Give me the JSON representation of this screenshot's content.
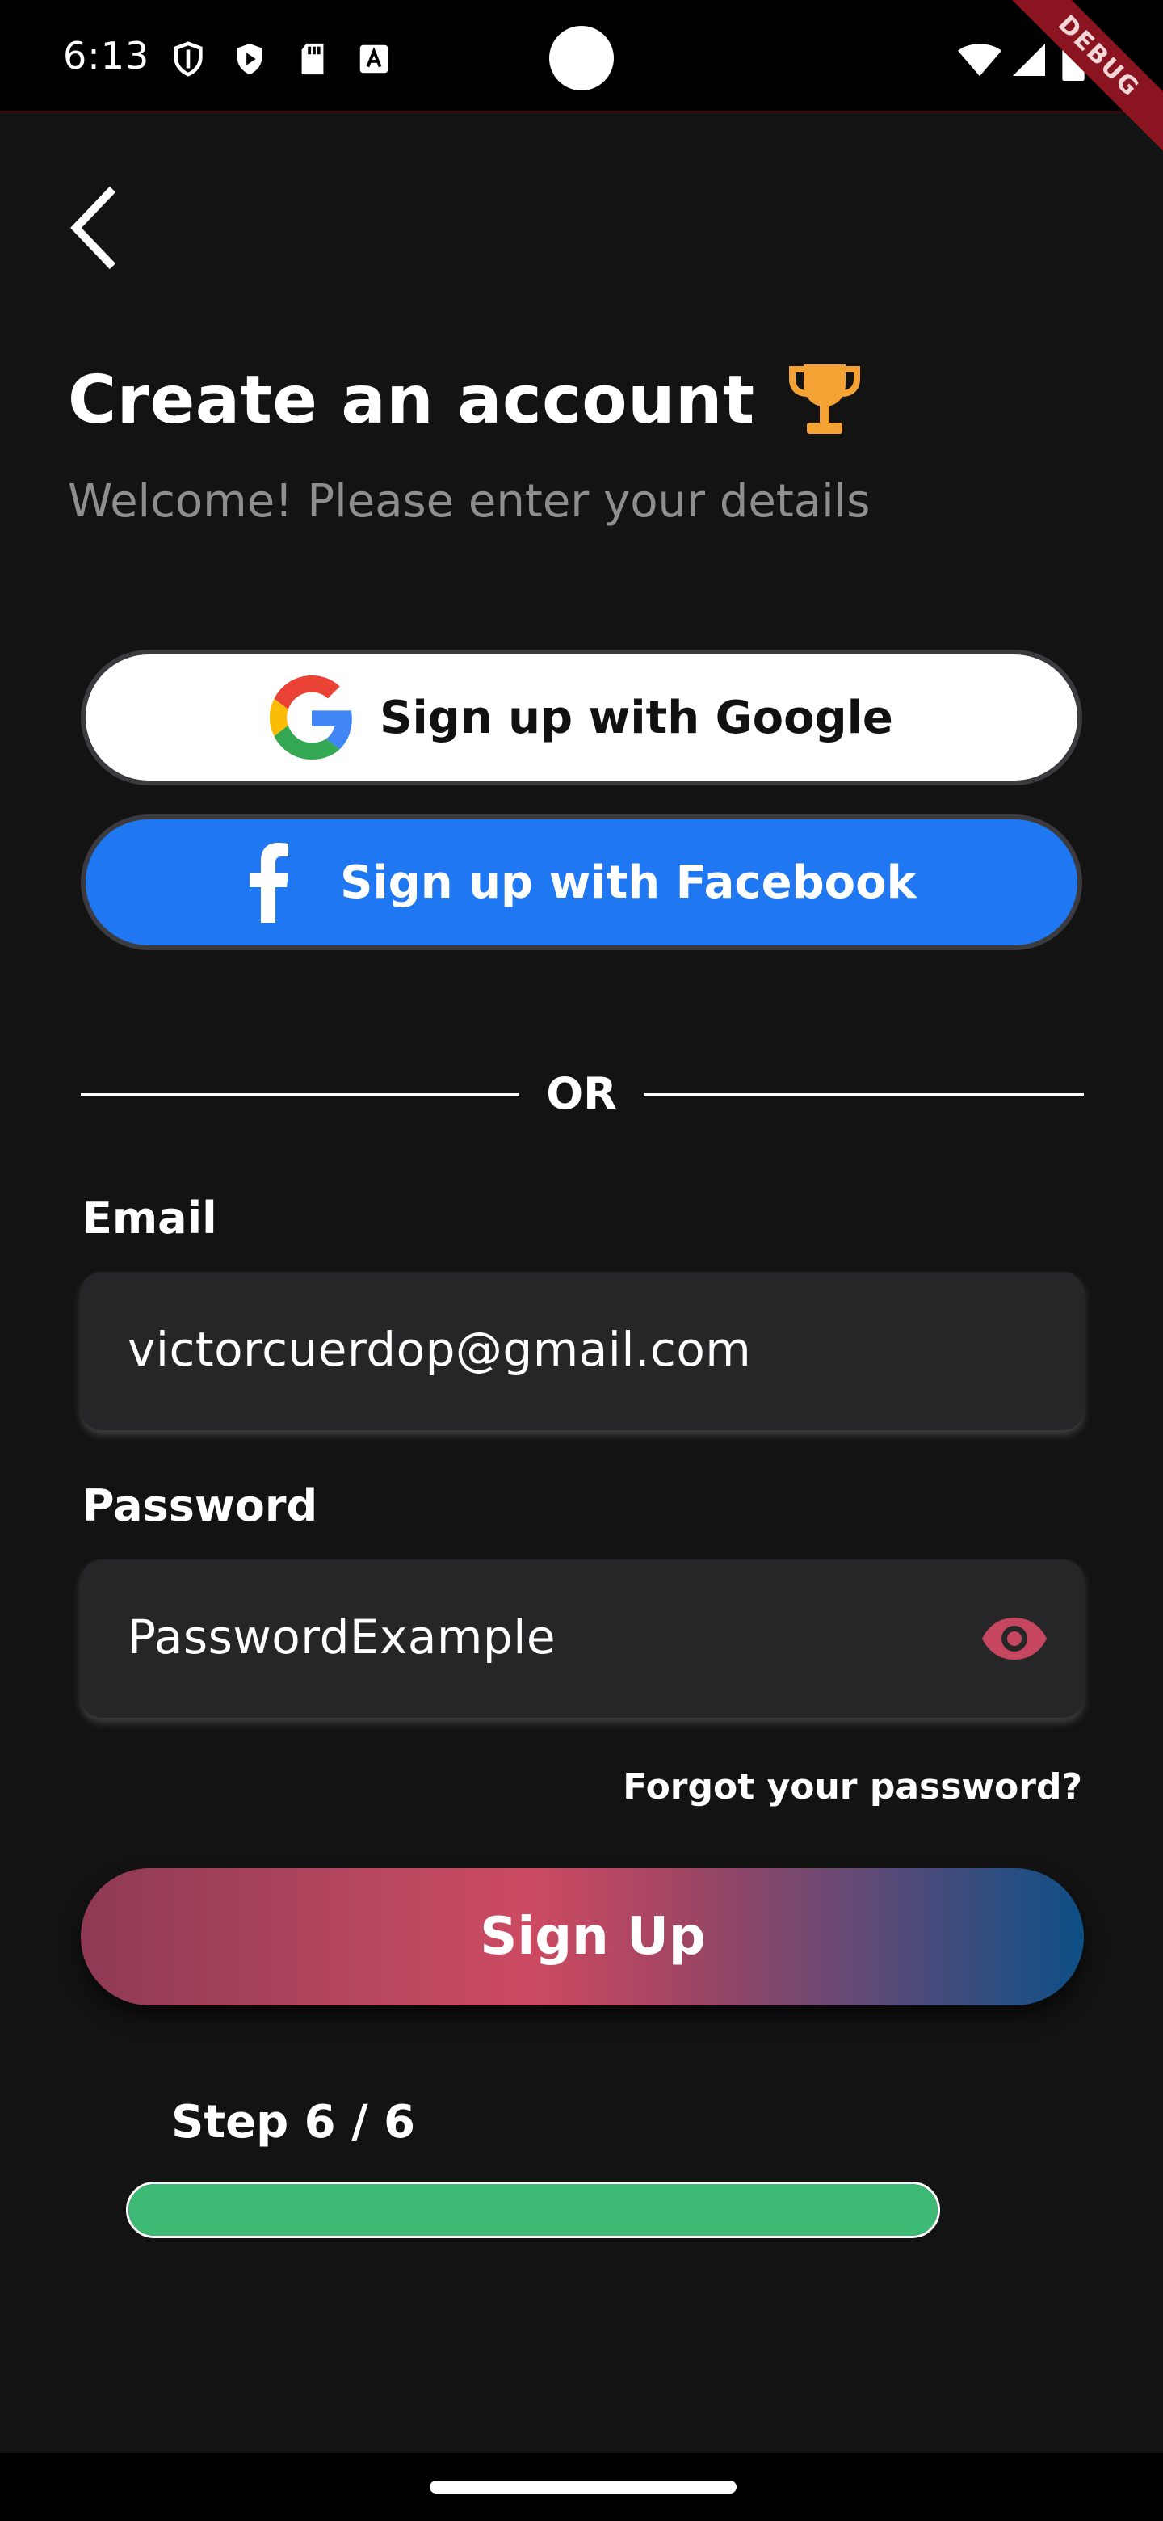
{
  "status_bar": {
    "time": "6:13",
    "icons": [
      "shield-icon",
      "play-icon",
      "sd-card-icon",
      "font-icon",
      "wifi-icon",
      "signal-icon",
      "battery-icon"
    ],
    "debug_banner": "DEBUG"
  },
  "header": {
    "back_icon": "chevron-left-icon",
    "title": "Create an account",
    "title_icon": "trophy-icon",
    "subtitle": "Welcome! Please enter your details"
  },
  "social": {
    "google_label": "Sign up with Google",
    "facebook_label": "Sign up with Facebook"
  },
  "divider": {
    "text": "OR"
  },
  "form": {
    "email_label": "Email",
    "email_value": "victorcuerdop@gmail.com",
    "password_label": "Password",
    "password_value": "PasswordExample",
    "forgot_label": "Forgot your password?",
    "submit_label": "Sign Up"
  },
  "progress": {
    "step_label": "Step 6 / 6",
    "current_step": 6,
    "total_steps": 6
  },
  "colors": {
    "background": "#131313",
    "accent_orange": "#f4a234",
    "facebook_blue": "#1f77f1",
    "eye_pink": "#c6475f",
    "progress_green": "#3dba74",
    "input_bg": "#262629"
  }
}
